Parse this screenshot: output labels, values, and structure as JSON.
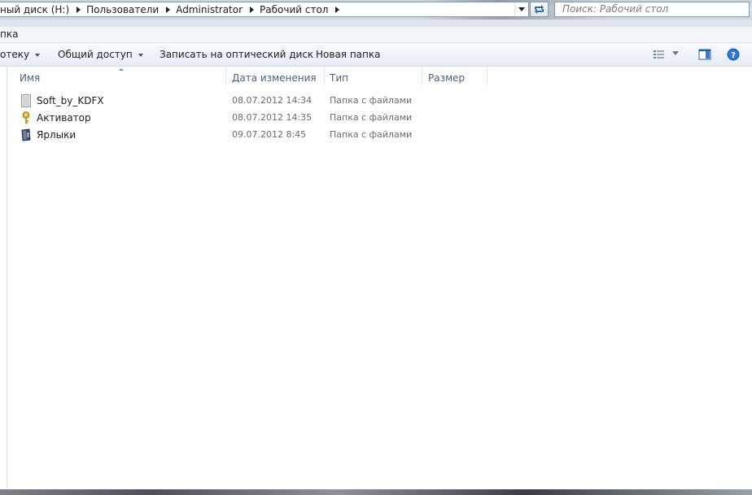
{
  "breadcrumb": {
    "items": [
      "ный диск (H:)",
      "Пользователи",
      "Administrator",
      "Рабочий стол"
    ]
  },
  "search": {
    "placeholder": "Поиск: Рабочий стол"
  },
  "menubar": {
    "label": "пка"
  },
  "toolbar": {
    "library_label": "отеку",
    "share_label": "Общий доступ",
    "burn_label": "Записать на оптический диск",
    "new_folder_label": "Новая папка"
  },
  "columns": {
    "name": "Имя",
    "date": "Дата изменения",
    "type": "Тип",
    "size": "Размер"
  },
  "files": [
    {
      "name": "Soft_by_KDFX",
      "date": "08.07.2012 14:34",
      "type": "Папка с файлами",
      "icon": "blank-file-icon"
    },
    {
      "name": "Активатор",
      "date": "08.07.2012 14:35",
      "type": "Папка с файлами",
      "icon": "key-icon"
    },
    {
      "name": "Ярлыки",
      "date": "09.07.2012 8:45",
      "type": "Папка с файлами",
      "icon": "shortcut-icon"
    }
  ],
  "colors": {
    "accent": "#2f6fb8",
    "header_text": "#4c607a",
    "meta_text": "#6d6d6d"
  }
}
